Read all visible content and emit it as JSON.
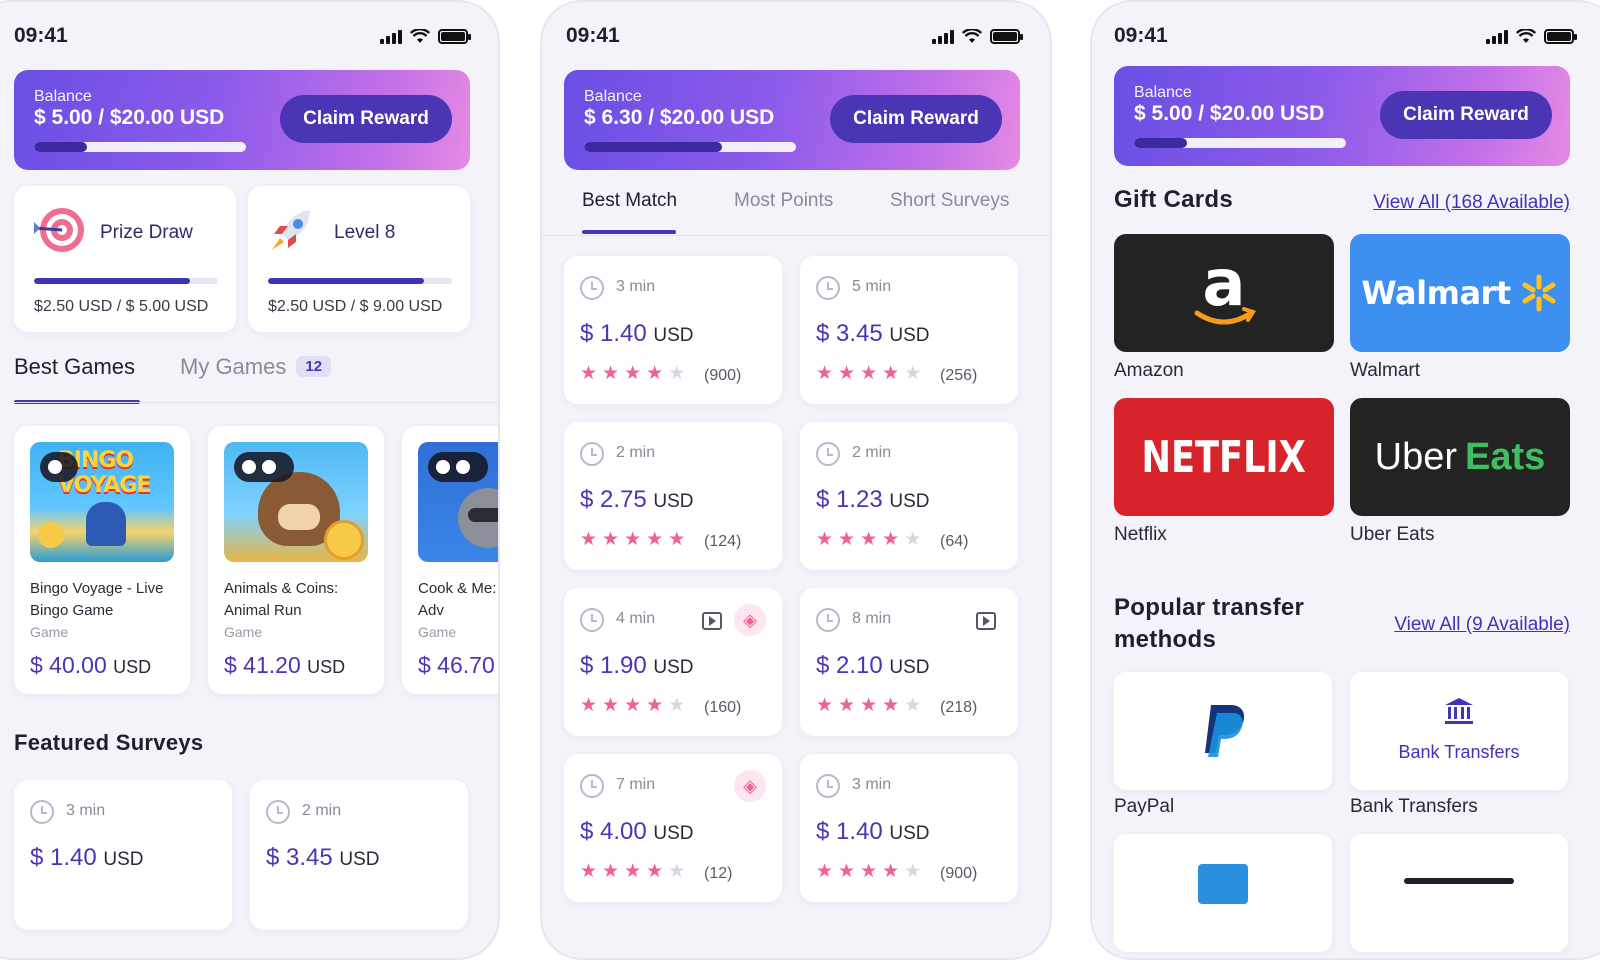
{
  "status": {
    "time": "09:41"
  },
  "screen1": {
    "balance": {
      "label": "Balance",
      "amount": "$ 5.00 / $20.00 USD",
      "progress": 0.25,
      "claim": "Claim Reward"
    },
    "mini_cards": [
      {
        "title": "Prize Draw",
        "value": "$2.50 USD / $ 5.00 USD",
        "progress": 0.85,
        "icon": "target-icon"
      },
      {
        "title": "Level 8",
        "value": "$2.50 USD / $ 9.00 USD",
        "progress": 0.85,
        "icon": "rocket-icon"
      }
    ],
    "tabs": {
      "best": "Best Games",
      "mine": "My Games",
      "mine_count": "12"
    },
    "games": [
      {
        "name": "Bingo Voyage - Live Bingo Game",
        "type": "Game",
        "price": "$ 40.00",
        "currency": "USD",
        "thumb_text": "BINGO VOYAGE"
      },
      {
        "name": "Animals & Coins: Animal Run",
        "type": "Game",
        "price": "$ 41.20",
        "currency": "USD"
      },
      {
        "name": "Cook & Me: Kate's Adv",
        "type": "Game",
        "price": "$ 46.70",
        "currency": ""
      }
    ],
    "featured_title": "Featured Surveys",
    "surveys": [
      {
        "time": "3 min",
        "price": "$ 1.40",
        "currency": "USD"
      },
      {
        "time": "2 min",
        "price": "$ 3.45",
        "currency": "USD"
      }
    ]
  },
  "screen2": {
    "balance": {
      "label": "Balance",
      "amount": "$ 6.30 / $20.00 USD",
      "progress": 0.65,
      "claim": "Claim Reward"
    },
    "tabs": [
      "Best Match",
      "Most Points",
      "Short Surveys"
    ],
    "surveys": [
      {
        "time": "3 min",
        "price": "$ 1.40",
        "currency": "USD",
        "rating": 4,
        "count": "(900)",
        "video": false,
        "hot": false
      },
      {
        "time": "5 min",
        "price": "$ 3.45",
        "currency": "USD",
        "rating": 4,
        "count": "(256)",
        "video": false,
        "hot": false
      },
      {
        "time": "2 min",
        "price": "$ 2.75",
        "currency": "USD",
        "rating": 5,
        "count": "(124)",
        "video": false,
        "hot": false
      },
      {
        "time": "2 min",
        "price": "$ 1.23",
        "currency": "USD",
        "rating": 4,
        "count": "(64)",
        "video": false,
        "hot": false
      },
      {
        "time": "4 min",
        "price": "$ 1.90",
        "currency": "USD",
        "rating": 4,
        "count": "(160)",
        "video": true,
        "hot": true
      },
      {
        "time": "8 min",
        "price": "$ 2.10",
        "currency": "USD",
        "rating": 4,
        "count": "(218)",
        "video": true,
        "hot": false
      },
      {
        "time": "7 min",
        "price": "$ 4.00",
        "currency": "USD",
        "rating": 4,
        "count": "(12)",
        "video": false,
        "hot": true
      },
      {
        "time": "3 min",
        "price": "$ 1.40",
        "currency": "USD",
        "rating": 4,
        "count": "(900)",
        "video": false,
        "hot": false
      }
    ]
  },
  "screen3": {
    "balance": {
      "label": "Balance",
      "amount": "$ 5.00 / $20.00 USD",
      "progress": 0.25,
      "claim": "Claim Reward"
    },
    "gift_title": "Gift Cards",
    "gift_view_all": "View All (168 Available)",
    "gifts": [
      {
        "name": "Amazon",
        "tile_text": "a",
        "bg": "#232323"
      },
      {
        "name": "Walmart",
        "tile_text": "Walmart",
        "bg": "#3d8ff0"
      },
      {
        "name": "Netflix",
        "tile_text": "NETFLIX",
        "bg": "#d9232b"
      },
      {
        "name": "Uber Eats",
        "tile_text_1": "Uber",
        "tile_text_2": "Eats",
        "bg": "#232323"
      }
    ],
    "transfer_title_1": "Popular transfer",
    "transfer_title_2": "methods",
    "transfer_view_all": "View All (9 Available)",
    "methods": [
      {
        "name": "PayPal"
      },
      {
        "name": "Bank Transfers",
        "tile_text": "Bank Transfers"
      }
    ]
  },
  "colors": {
    "accent": "#4a35b5",
    "star": "#ef5f98"
  }
}
